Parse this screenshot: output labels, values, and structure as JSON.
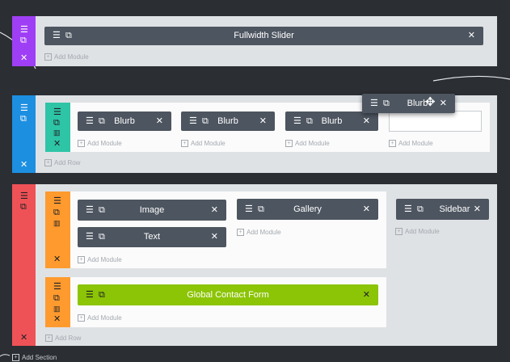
{
  "colors": {
    "background": "#2b2e33",
    "section_panel": "#dfe2e5",
    "section1_bar": "#9f3ff5",
    "section2_bar": "#1d8fe1",
    "section3_bar": "#ef5256",
    "row_teal": "#2ec4a6",
    "row_orange": "#ff9a2e",
    "module": "#4d5560",
    "module_global": "#8cc406"
  },
  "icons": {
    "menu": "hamburger-icon",
    "duplicate": "duplicate-icon",
    "close": "close-icon",
    "columns": "columns-icon",
    "move": "move-icon",
    "add": "plus-icon"
  },
  "add_module_label": "Add Module",
  "add_row_label": "Add Row",
  "add_section_label": "Add Section",
  "sections": [
    {
      "modules": [
        "Fullwidth Slider"
      ]
    },
    {
      "modules": [
        "Blurb",
        "Blurb",
        "Blurb"
      ]
    },
    {
      "row1_col1": [
        "Image",
        "Text"
      ],
      "row1_col2": [
        "Gallery"
      ],
      "sidebar": "Sidebar",
      "row2_module": "Global Contact Form"
    }
  ],
  "dragging_module": "Blurb"
}
